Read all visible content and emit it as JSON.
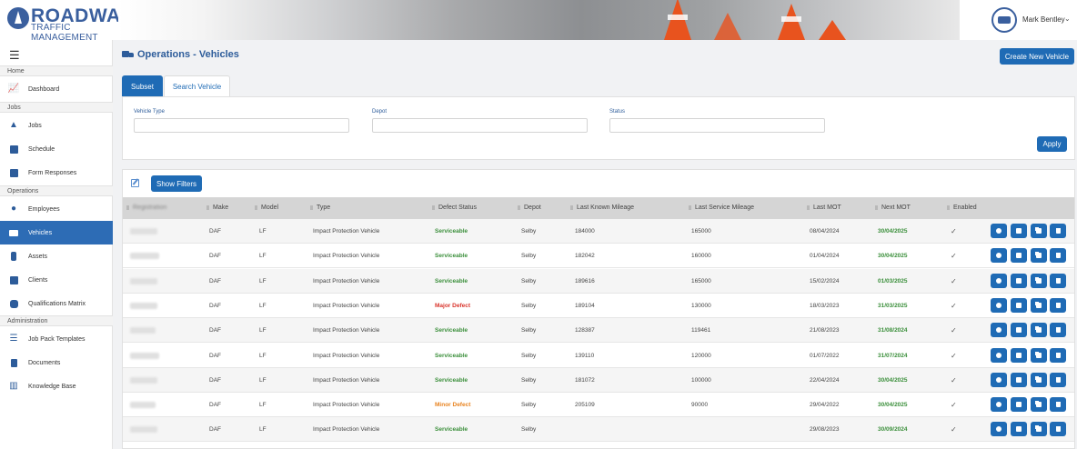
{
  "brand": {
    "logo_main": "ROADWAY",
    "logo_sub": "TRAFFIC MANAGEMENT",
    "user_name": "Mark Bentley",
    "accent": "#1f6bb5"
  },
  "sidebar": {
    "sections": [
      {
        "label": "Home"
      },
      {
        "label": "Jobs"
      },
      {
        "label": "Operations"
      },
      {
        "label": "Administration"
      }
    ],
    "items": [
      {
        "label": "Dashboard",
        "icon": "chart-line-icon"
      },
      {
        "label": "Jobs",
        "icon": "traffic-cone-icon"
      },
      {
        "label": "Schedule",
        "icon": "calendar-icon"
      },
      {
        "label": "Form Responses",
        "icon": "clipboard-icon"
      },
      {
        "label": "Employees",
        "icon": "user-icon"
      },
      {
        "label": "Vehicles",
        "icon": "truck-icon"
      },
      {
        "label": "Assets",
        "icon": "barrier-icon"
      },
      {
        "label": "Clients",
        "icon": "id-badge-icon"
      },
      {
        "label": "Qualifications Matrix",
        "icon": "certificate-icon"
      },
      {
        "label": "Job Pack Templates",
        "icon": "list-icon"
      },
      {
        "label": "Documents",
        "icon": "document-icon"
      },
      {
        "label": "Knowledge Base",
        "icon": "books-icon"
      }
    ]
  },
  "page": {
    "title": "Operations - Vehicles",
    "create_button": "Create New Vehicle"
  },
  "tabs": [
    {
      "label": "Subset",
      "active": true
    },
    {
      "label": "Search Vehicle",
      "active": false
    }
  ],
  "filters": {
    "vehicle_type_label": "Vehicle Type",
    "depot_label": "Depot",
    "status_label": "Status",
    "apply_button": "Apply"
  },
  "table": {
    "show_filters_button": "Show Filters",
    "columns": [
      "Registration",
      "Make",
      "Model",
      "Type",
      "Defect Status",
      "Depot",
      "Last Known Mileage",
      "Last Service Mileage",
      "Last MOT",
      "Next MOT",
      "Enabled"
    ],
    "rows": [
      {
        "make": "DAF",
        "model": "LF",
        "type": "Impact Protection Vehicle",
        "defect": "Serviceable",
        "depot": "Selby",
        "last_known": "184000",
        "last_service": "165000",
        "last_mot": "08/04/2024",
        "next_mot": "30/04/2025",
        "enabled": "✓"
      },
      {
        "make": "DAF",
        "model": "LF",
        "type": "Impact Protection Vehicle",
        "defect": "Serviceable",
        "depot": "Selby",
        "last_known": "182042",
        "last_service": "160000",
        "last_mot": "01/04/2024",
        "next_mot": "30/04/2025",
        "enabled": "✓"
      },
      {
        "make": "DAF",
        "model": "LF",
        "type": "Impact Protection Vehicle",
        "defect": "Serviceable",
        "depot": "Selby",
        "last_known": "189616",
        "last_service": "165000",
        "last_mot": "15/02/2024",
        "next_mot": "01/03/2025",
        "enabled": "✓"
      },
      {
        "make": "DAF",
        "model": "LF",
        "type": "Impact Protection Vehicle",
        "defect": "Major Defect",
        "depot": "Selby",
        "last_known": "189104",
        "last_service": "130000",
        "last_mot": "18/03/2023",
        "next_mot": "31/03/2025",
        "enabled": "✓"
      },
      {
        "make": "DAF",
        "model": "LF",
        "type": "Impact Protection Vehicle",
        "defect": "Serviceable",
        "depot": "Selby",
        "last_known": "128387",
        "last_service": "119461",
        "last_mot": "21/08/2023",
        "next_mot": "31/08/2024",
        "enabled": "✓"
      },
      {
        "make": "DAF",
        "model": "LF",
        "type": "Impact Protection Vehicle",
        "defect": "Serviceable",
        "depot": "Selby",
        "last_known": "139110",
        "last_service": "120000",
        "last_mot": "01/07/2022",
        "next_mot": "31/07/2024",
        "enabled": "✓"
      },
      {
        "make": "DAF",
        "model": "LF",
        "type": "Impact Protection Vehicle",
        "defect": "Serviceable",
        "depot": "Selby",
        "last_known": "181072",
        "last_service": "100000",
        "last_mot": "22/04/2024",
        "next_mot": "30/04/2025",
        "enabled": "✓"
      },
      {
        "make": "DAF",
        "model": "LF",
        "type": "Impact Protection Vehicle",
        "defect": "Minor Defect",
        "depot": "Selby",
        "last_known": "205109",
        "last_service": "90000",
        "last_mot": "29/04/2022",
        "next_mot": "30/04/2025",
        "enabled": "✓"
      },
      {
        "make": "DAF",
        "model": "LF",
        "type": "Impact Protection Vehicle",
        "defect": "Serviceable",
        "depot": "Selby",
        "last_known": "",
        "last_service": "",
        "last_mot": "29/08/2023",
        "next_mot": "30/09/2024",
        "enabled": "✓"
      }
    ]
  },
  "colors": {
    "serviceable": "#3b8f3b",
    "major_defect": "#d9342b",
    "minor_defect": "#e8831f"
  }
}
